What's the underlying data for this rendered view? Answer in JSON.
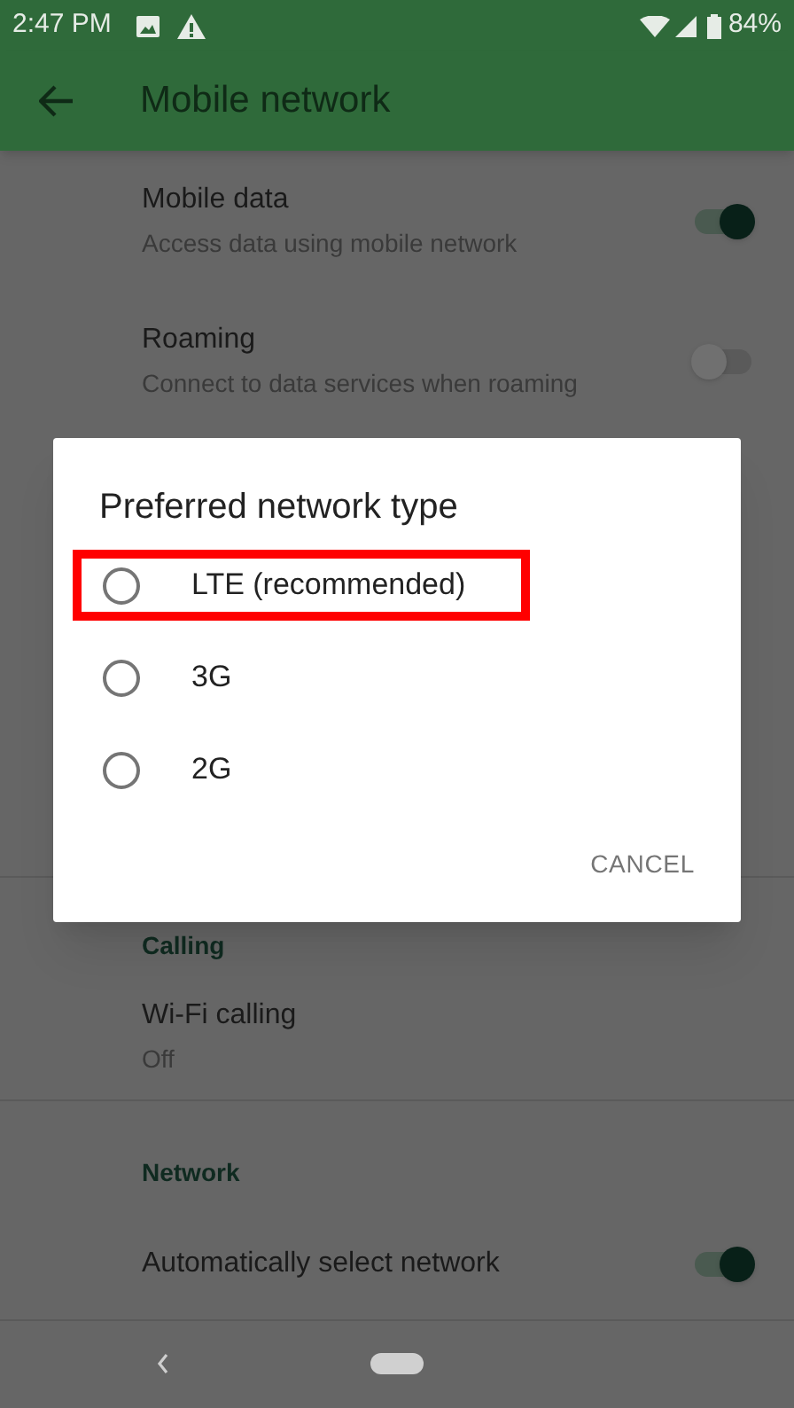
{
  "status_bar": {
    "time": "2:47 PM",
    "battery": "84%"
  },
  "app_bar": {
    "title": "Mobile network"
  },
  "settings": [
    {
      "kind": "toggle",
      "title": "Mobile data",
      "subtitle": "Access data using mobile network",
      "on": true
    },
    {
      "kind": "toggle",
      "title": "Roaming",
      "subtitle": "Connect to data services when roaming",
      "on": false
    }
  ],
  "sections": [
    {
      "header": "Calling",
      "items": [
        {
          "kind": "text",
          "title": "Wi-Fi calling",
          "subtitle": "Off"
        }
      ]
    },
    {
      "header": "Network",
      "items": [
        {
          "kind": "toggle",
          "title": "Automatically select network",
          "on": true
        }
      ]
    }
  ],
  "dialog": {
    "title": "Preferred network type",
    "options": [
      {
        "label": "LTE (recommended)",
        "selected": false,
        "highlighted": true
      },
      {
        "label": "3G",
        "selected": false,
        "highlighted": false
      },
      {
        "label": "2G",
        "selected": false,
        "highlighted": false
      }
    ],
    "button": "CANCEL"
  }
}
